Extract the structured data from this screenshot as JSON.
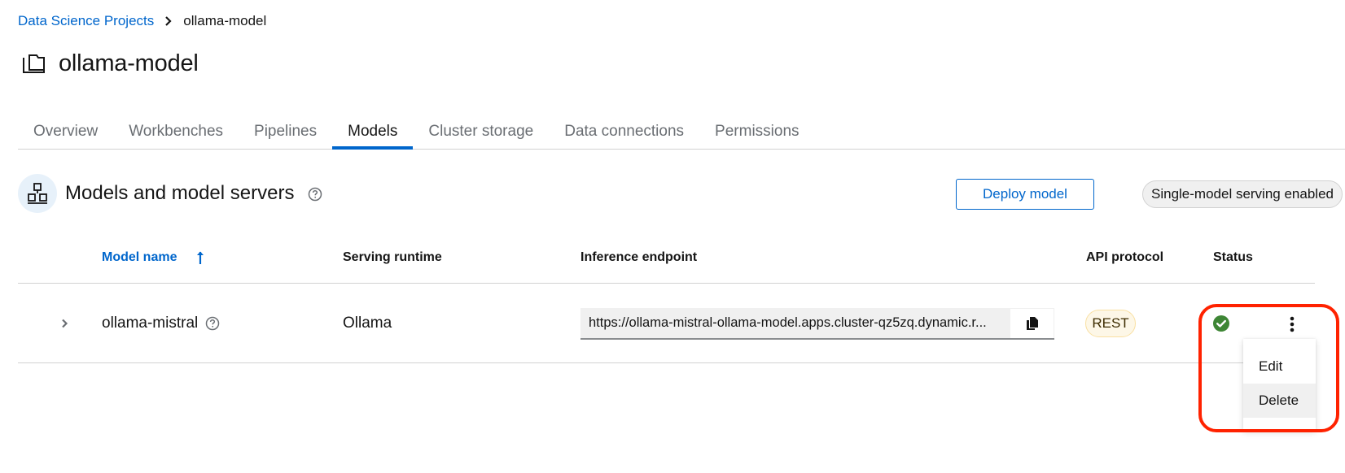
{
  "breadcrumb": {
    "items": [
      {
        "label": "Data Science Projects",
        "link": true
      },
      {
        "label": "ollama-model",
        "link": false
      }
    ]
  },
  "page": {
    "title": "ollama-model",
    "icon": "project-folder-icon"
  },
  "tabs": [
    {
      "label": "Overview",
      "active": false
    },
    {
      "label": "Workbenches",
      "active": false
    },
    {
      "label": "Pipelines",
      "active": false
    },
    {
      "label": "Models",
      "active": true
    },
    {
      "label": "Cluster storage",
      "active": false
    },
    {
      "label": "Data connections",
      "active": false
    },
    {
      "label": "Permissions",
      "active": false
    }
  ],
  "section": {
    "title": "Models and model servers",
    "icon": "model-server-icon",
    "deploy_button": "Deploy model",
    "serving_label": "Single-model serving enabled"
  },
  "table": {
    "columns": [
      {
        "label": "Model name",
        "sorted": "ascending"
      },
      {
        "label": "Serving runtime"
      },
      {
        "label": "Inference endpoint"
      },
      {
        "label": "API protocol"
      },
      {
        "label": "Status"
      }
    ],
    "rows": [
      {
        "model_name": "ollama-mistral",
        "serving_runtime": "Ollama",
        "inference_endpoint": "https://ollama-mistral-ollama-model.apps.cluster-qz5zq.dynamic.r...",
        "api_protocol": "REST",
        "status": "success"
      }
    ]
  },
  "actions_menu": {
    "items": [
      {
        "label": "Edit",
        "hovered": false
      },
      {
        "label": "Delete",
        "hovered": true
      }
    ]
  },
  "colors": {
    "accent": "#0066cc",
    "status_success": "#3e8635",
    "highlight": "#ff2200",
    "badge_bg": "#fdf7e7",
    "badge_border": "#f9e0a2"
  }
}
